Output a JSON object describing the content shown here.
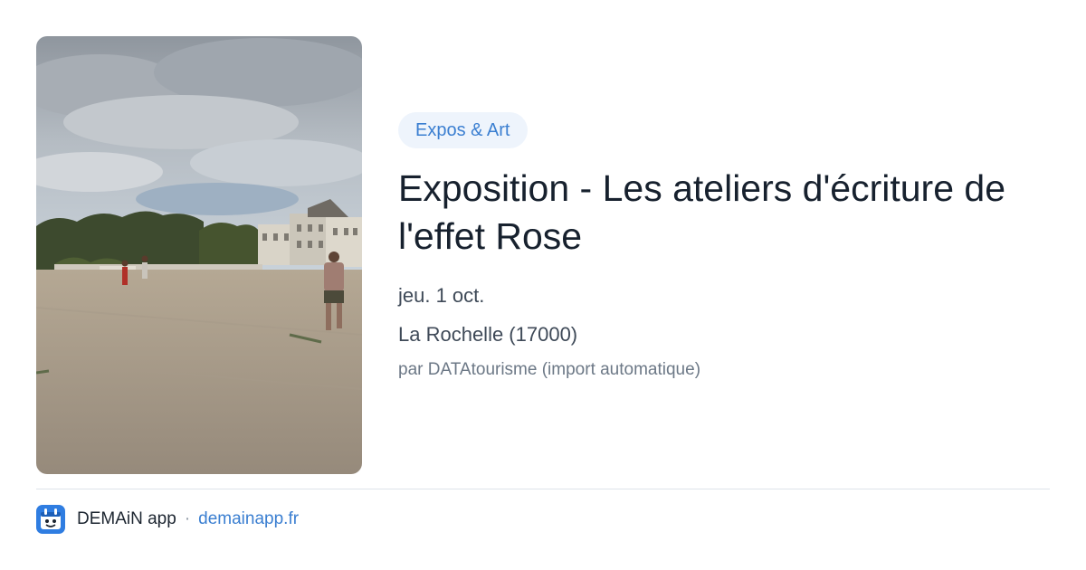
{
  "event": {
    "category": "Expos & Art",
    "title": "Exposition - Les ateliers d'écriture de l'effet Rose",
    "date": "jeu. 1 oct.",
    "location": "La Rochelle (17000)",
    "author": "par DATAtourisme (import automatique)"
  },
  "footer": {
    "app_name": "DEMAiN app",
    "separator": "·",
    "domain": "demainapp.fr"
  },
  "colors": {
    "accent": "#3b7fd1",
    "tag_background": "#eef4fc",
    "title": "#17212e"
  },
  "icons": {
    "app": "demain-app-icon"
  },
  "image": {
    "description_icon": "event-photo"
  }
}
